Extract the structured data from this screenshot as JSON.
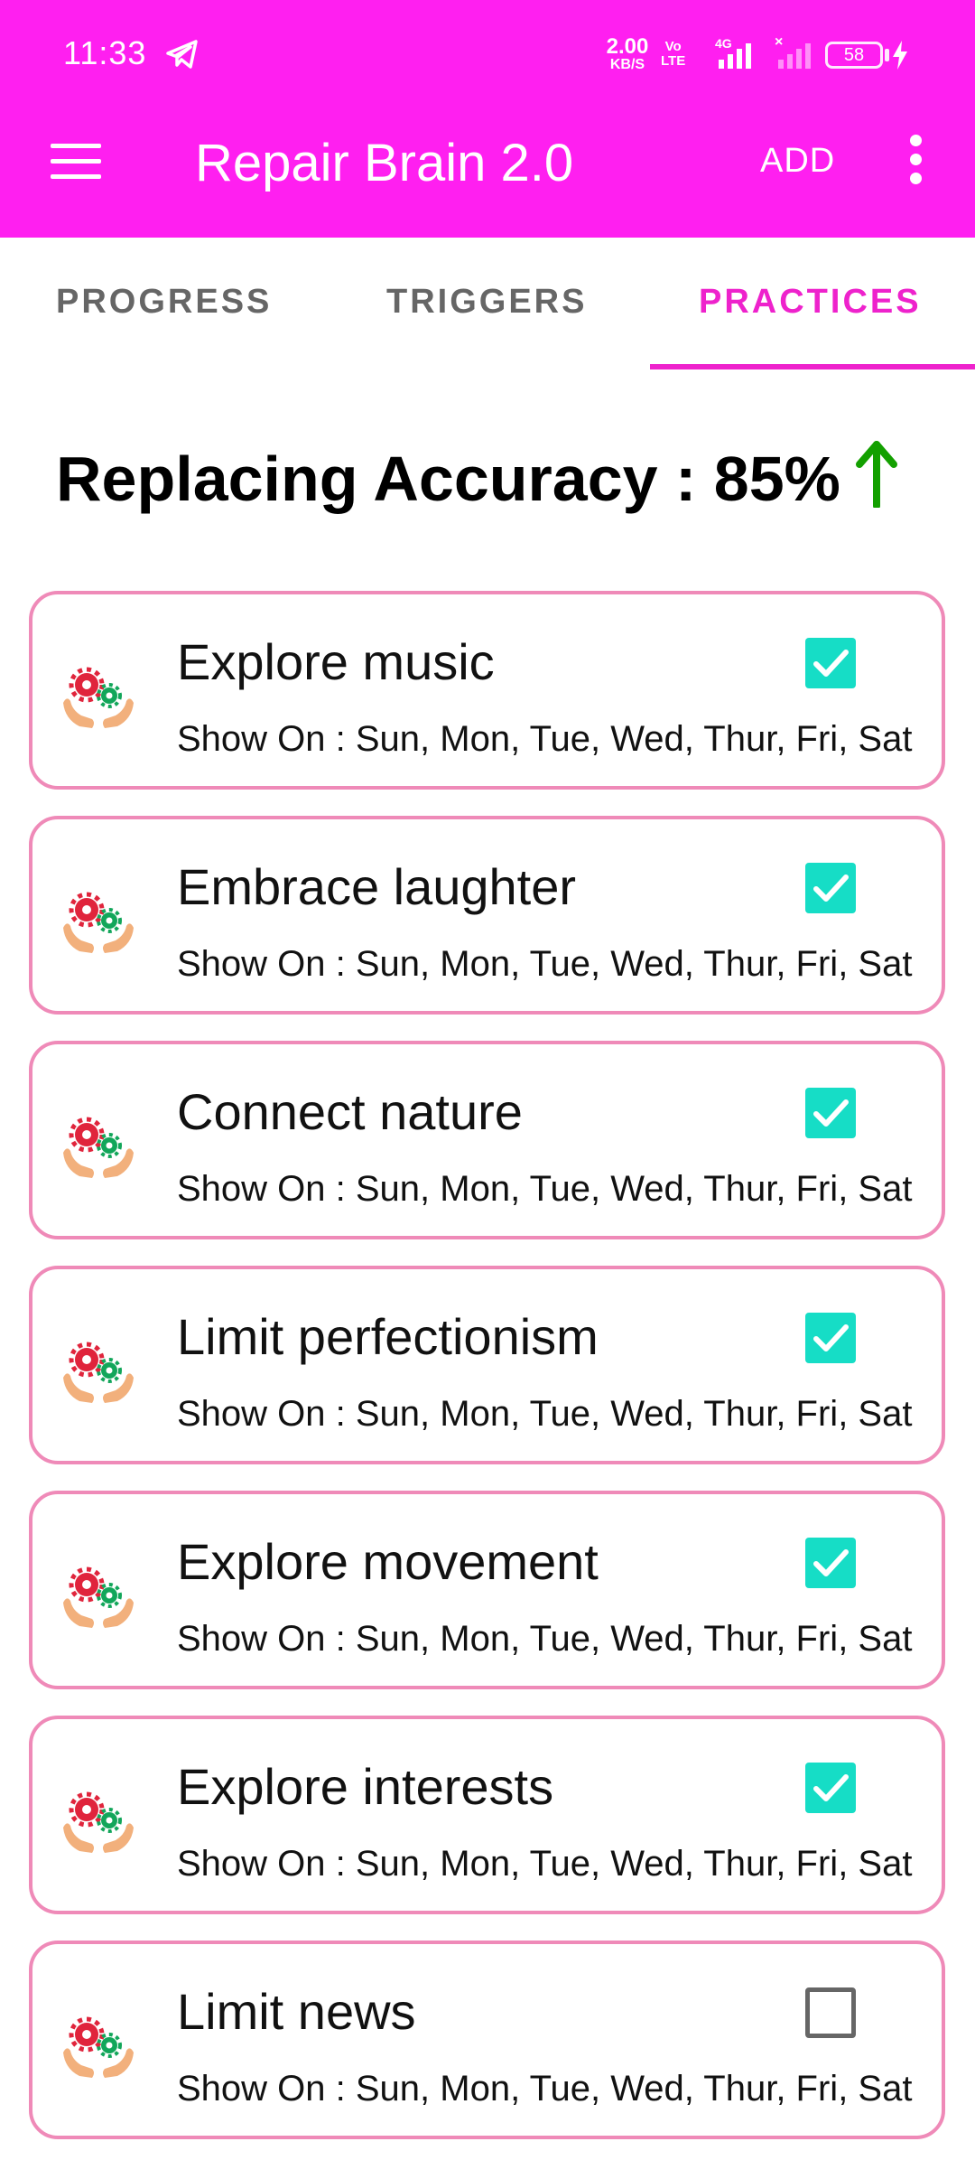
{
  "status_bar": {
    "time": "11:33",
    "net_speed_value": "2.00",
    "net_speed_unit": "KB/S",
    "volte_top": "Vo",
    "volte_bottom": "LTE",
    "network_type": "4G",
    "battery_level": "58"
  },
  "app_bar": {
    "title": "Repair Brain 2.0",
    "add_label": "ADD"
  },
  "tabs": [
    {
      "label": "PROGRESS",
      "selected": false
    },
    {
      "label": "TRIGGERS",
      "selected": false
    },
    {
      "label": "PRACTICES",
      "selected": true
    }
  ],
  "accuracy": {
    "text": "Replacing Accuracy : 85%",
    "trend": "up",
    "trend_color": "#13a000"
  },
  "colors": {
    "accent": "#ff1ff0",
    "tab_selected": "#ee22cc",
    "card_border": "#ef8ab8",
    "checkbox_checked": "#16ddc6"
  },
  "practices": [
    {
      "title": "Explore music",
      "show_on": "Show On :  Sun, Mon, Tue, Wed, Thur, Fri, Sat",
      "checked": true
    },
    {
      "title": "Embrace laughter",
      "show_on": "Show On :  Sun, Mon, Tue, Wed, Thur, Fri, Sat",
      "checked": true
    },
    {
      "title": "Connect nature",
      "show_on": "Show On :  Sun, Mon, Tue, Wed, Thur, Fri, Sat",
      "checked": true
    },
    {
      "title": "Limit perfectionism",
      "show_on": "Show On :  Sun, Mon, Tue, Wed, Thur, Fri, Sat",
      "checked": true
    },
    {
      "title": "Explore movement",
      "show_on": "Show On :  Sun, Mon, Tue, Wed, Thur, Fri, Sat",
      "checked": true
    },
    {
      "title": "Explore interests",
      "show_on": "Show On :  Sun, Mon, Tue, Wed, Thur, Fri, Sat",
      "checked": true
    },
    {
      "title": "Limit news",
      "show_on": "Show On :  Sun, Mon, Tue, Wed, Thur, Fri, Sat",
      "checked": false
    }
  ]
}
